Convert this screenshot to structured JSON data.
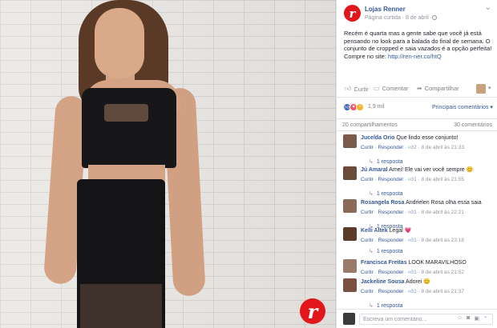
{
  "post": {
    "page_name": "Lojas Renner",
    "meta": "Página curtida · 8 de abril",
    "text": "Recém é quarta mas a gente sabe que você já está pensando no look para a balada do final de semana. O conjunto de cropped e saia vazados é a opção perfeita! Compre no site: ",
    "link_text": "http://ren-ner.co/htQ",
    "brand_logo_letter": "r"
  },
  "actions": {
    "like": "Curtir",
    "comment": "Comentar",
    "share": "Compartilhar"
  },
  "reactions": {
    "count": "1,9 mil",
    "sort": "Principais comentários ▾"
  },
  "stats": {
    "shares": "20 compartilhamentos",
    "comments": "30 comentários"
  },
  "comments": [
    {
      "author": "Jucelda Orio",
      "text": " Que lindo esse conjunto!",
      "like": "Curtir",
      "reply": "Responder",
      "likes": "2",
      "time": "8 de abril às 21:33",
      "replies": "1 resposta",
      "avatar_color": "#7a5a4a"
    },
    {
      "author": "Jú Amaral",
      "text": " Amei! Ele vai ver você sempre 😊",
      "like": "Curtir",
      "reply": "Responder",
      "likes": "1",
      "time": "8 de abril às 21:55",
      "replies": "1 resposta",
      "avatar_color": "#6b4b3a"
    },
    {
      "author": "Rosangela Rosa",
      "text": " Andrielen Rosa olha essa saia",
      "like": "Curtir",
      "reply": "Responder",
      "likes": "1",
      "time": "8 de abril às 22:21",
      "replies": "1 resposta",
      "avatar_color": "#8b6a5a"
    },
    {
      "author": "Kelli Altek",
      "text": " Legal 💗",
      "like": "Curtir",
      "reply": "Responder",
      "likes": "1",
      "time": "8 de abril às 23:18",
      "replies": "1 resposta",
      "avatar_color": "#5b3b2a"
    },
    {
      "author": "Francisca Freitas",
      "text": " LOOK MARAVILHOSO",
      "like": "Curtir",
      "reply": "Responder",
      "likes": "1",
      "time": "8 de abril às 21:52",
      "replies": "",
      "avatar_color": "#9a7a6a"
    },
    {
      "author": "Jackeline Sousa",
      "text": " Adorei 😊",
      "like": "Curtir",
      "reply": "Responder",
      "likes": "2",
      "time": "8 de abril às 21:37",
      "replies": "1 resposta",
      "avatar_color": "#7b5040"
    }
  ],
  "comment_input": {
    "placeholder": "Escreva um comentário..."
  },
  "colors": {
    "brand": "#e3171b",
    "link": "#365899",
    "muted": "#90949c"
  }
}
